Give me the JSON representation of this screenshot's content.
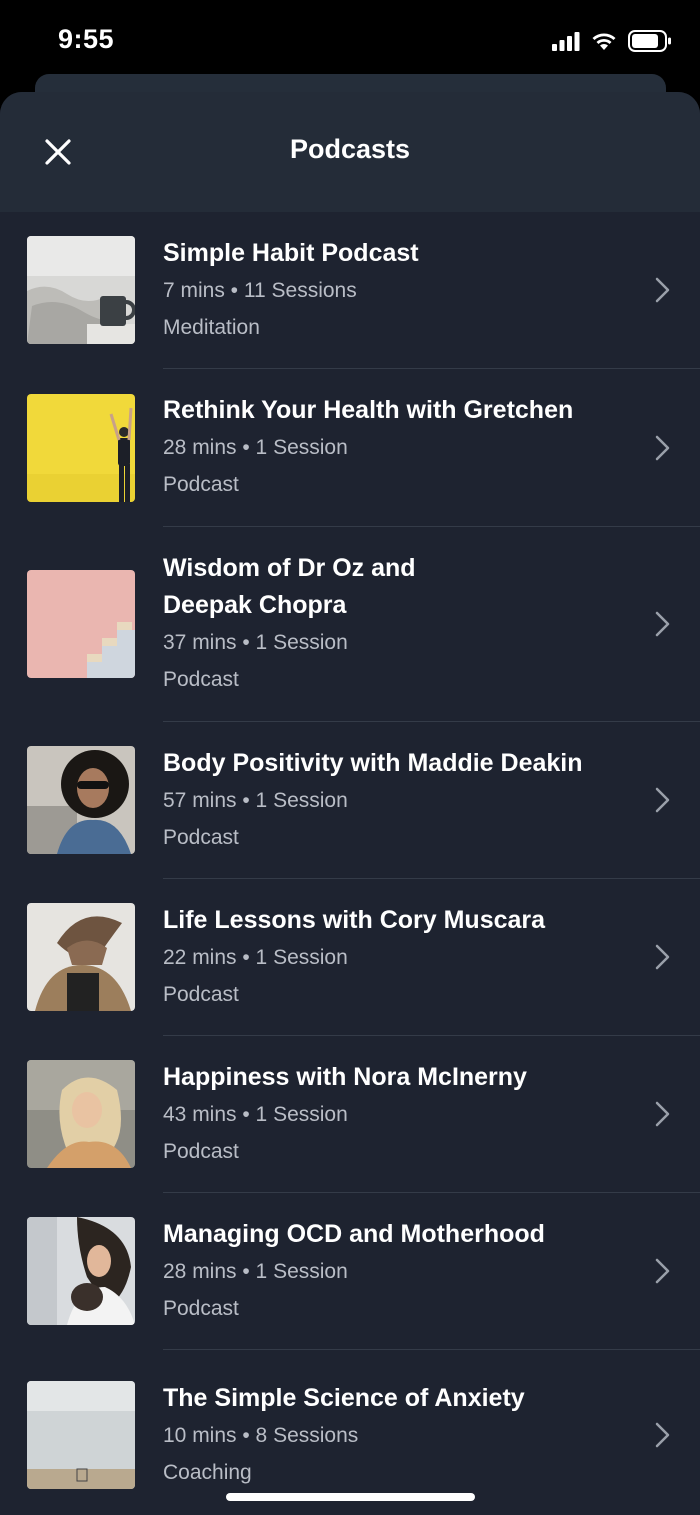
{
  "status_bar": {
    "time": "9:55"
  },
  "header": {
    "title": "Podcasts"
  },
  "items": [
    {
      "title": "Simple Habit Podcast",
      "meta": "7 mins • 11 Sessions",
      "category": "Meditation",
      "thumb": "bed-coffee"
    },
    {
      "title": "Rethink Your Health with Gretchen",
      "meta": "28 mins • 1 Session",
      "category": "Podcast",
      "thumb": "yellow-wall"
    },
    {
      "title": "Wisdom of Dr Oz and\nDeepak Chopra",
      "meta": "37 mins • 1 Session",
      "category": "Podcast",
      "thumb": "pink-stairs"
    },
    {
      "title": "Body Positivity with Maddie Deakin",
      "meta": "57 mins • 1 Session",
      "category": "Podcast",
      "thumb": "curly-hair"
    },
    {
      "title": "Life Lessons with Cory Muscara",
      "meta": "22 mins • 1 Session",
      "category": "Podcast",
      "thumb": "hair-flip"
    },
    {
      "title": "Happiness with Nora McInerny",
      "meta": "43 mins • 1 Session",
      "category": "Podcast",
      "thumb": "blonde-woman"
    },
    {
      "title": "Managing OCD and Motherhood",
      "meta": "28 mins • 1 Session",
      "category": "Podcast",
      "thumb": "mother-baby"
    },
    {
      "title": "The Simple Science of Anxiety",
      "meta": "10 mins • 8 Sessions",
      "category": "Coaching",
      "thumb": "beach"
    }
  ],
  "colors": {
    "sheet_bg": "#1e2330",
    "header_bg": "#242c38",
    "divider": "#343b48",
    "secondary_text": "#b9bdc6"
  }
}
